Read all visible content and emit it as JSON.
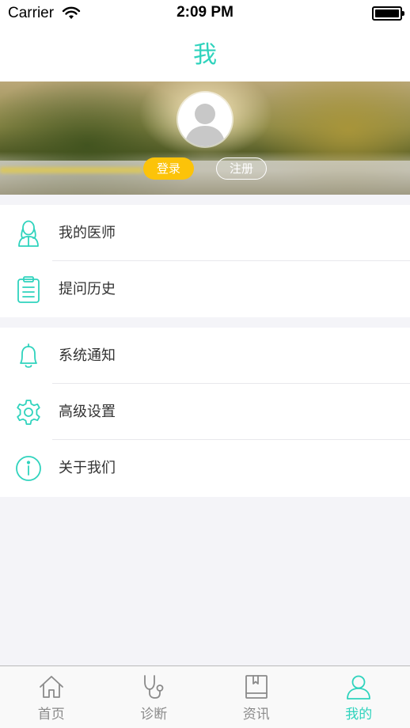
{
  "status_bar": {
    "carrier": "Carrier",
    "time": "2:09 PM"
  },
  "nav": {
    "title": "我"
  },
  "profile": {
    "login_label": "登录",
    "register_label": "注册"
  },
  "menu": {
    "group1": [
      {
        "label": "我的医师",
        "icon": "doctor-icon"
      },
      {
        "label": "提问历史",
        "icon": "clipboard-icon"
      }
    ],
    "group2": [
      {
        "label": "系统通知",
        "icon": "bell-icon"
      },
      {
        "label": "高级设置",
        "icon": "gear-icon"
      },
      {
        "label": "关于我们",
        "icon": "info-icon"
      }
    ]
  },
  "tabs": [
    {
      "label": "首页",
      "icon": "home-icon",
      "active": false
    },
    {
      "label": "诊断",
      "icon": "stethoscope-icon",
      "active": false
    },
    {
      "label": "资讯",
      "icon": "book-icon",
      "active": false
    },
    {
      "label": "我的",
      "icon": "person-icon",
      "active": true
    }
  ],
  "colors": {
    "accent": "#2fd3bd",
    "login_button": "#f9c312",
    "inactive_tab": "#8a8a8a"
  }
}
